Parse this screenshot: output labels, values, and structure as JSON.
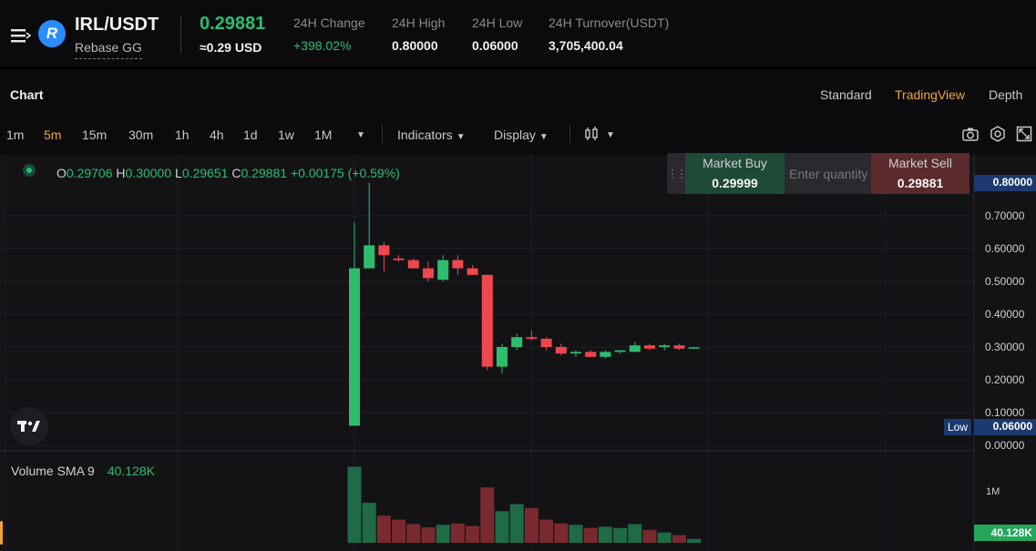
{
  "header": {
    "symbol": "IRL/USDT",
    "project": "Rebase GG",
    "logo_letter": "R",
    "last_price": "0.29881",
    "price_usd": "≈0.29 USD",
    "stats": [
      {
        "label": "24H Change",
        "value": "+398.02%"
      },
      {
        "label": "24H High",
        "value": "0.80000"
      },
      {
        "label": "24H Low",
        "value": "0.06000"
      },
      {
        "label": "24H Turnover(USDT)",
        "value": "3,705,400.04"
      }
    ]
  },
  "chart_header": {
    "title": "Chart",
    "views": [
      "Standard",
      "TradingView",
      "Depth"
    ],
    "active_view": "TradingView"
  },
  "toolbar": {
    "timeframes": [
      "1m",
      "5m",
      "15m",
      "30m",
      "1h",
      "4h",
      "1d",
      "1w",
      "1M"
    ],
    "active_timeframe": "5m",
    "indicators_label": "Indicators",
    "display_label": "Display",
    "icons": [
      "menu-icon",
      "candle-type-icon",
      "camera-icon",
      "settings-icon",
      "fullscreen-icon",
      "tradingview-logo-icon"
    ]
  },
  "ohlc": {
    "open_key": "O",
    "open": "0.29706",
    "high_key": "H",
    "high": "0.30000",
    "low_key": "L",
    "low": "0.29651",
    "close_key": "C",
    "close": "0.29881",
    "change": "+0.00175 (+0.59%)"
  },
  "trade_widget": {
    "buy_label": "Market Buy",
    "buy_price": "0.29999",
    "qty_placeholder": "Enter quantity",
    "sell_label": "Market Sell",
    "sell_price": "0.29881"
  },
  "price_scale": {
    "ticks": [
      "0.70000",
      "0.60000",
      "0.50000",
      "0.40000",
      "0.30000",
      "0.20000",
      "0.10000",
      "0.00000"
    ],
    "high_tag": "0.80000",
    "low_label": "Low",
    "low_tag": "0.06000"
  },
  "volume": {
    "legend_label": "Volume SMA 9",
    "legend_value": "40.128K",
    "scale_tick": "1M",
    "tag": "40.128K"
  },
  "colors": {
    "up": "#2ebd6e",
    "down": "#f0464e",
    "accent": "#f0a33a",
    "vol_up": "#1e6b46",
    "vol_down": "#7a2a2e"
  },
  "chart_data": {
    "type": "candlestick",
    "ylim": [
      0,
      0.8
    ],
    "candles": [
      {
        "o": 0.06,
        "h": 0.68,
        "l": 0.06,
        "c": 0.54
      },
      {
        "o": 0.54,
        "h": 0.8,
        "l": 0.54,
        "c": 0.61
      },
      {
        "o": 0.61,
        "h": 0.62,
        "l": 0.53,
        "c": 0.58
      },
      {
        "o": 0.57,
        "h": 0.58,
        "l": 0.56,
        "c": 0.565
      },
      {
        "o": 0.565,
        "h": 0.57,
        "l": 0.54,
        "c": 0.54
      },
      {
        "o": 0.54,
        "h": 0.56,
        "l": 0.5,
        "c": 0.51
      },
      {
        "o": 0.505,
        "h": 0.58,
        "l": 0.5,
        "c": 0.565
      },
      {
        "o": 0.565,
        "h": 0.58,
        "l": 0.52,
        "c": 0.54
      },
      {
        "o": 0.54,
        "h": 0.55,
        "l": 0.52,
        "c": 0.52
      },
      {
        "o": 0.52,
        "h": 0.52,
        "l": 0.23,
        "c": 0.24
      },
      {
        "o": 0.24,
        "h": 0.31,
        "l": 0.22,
        "c": 0.3
      },
      {
        "o": 0.3,
        "h": 0.34,
        "l": 0.29,
        "c": 0.33
      },
      {
        "o": 0.33,
        "h": 0.35,
        "l": 0.32,
        "c": 0.325
      },
      {
        "o": 0.325,
        "h": 0.33,
        "l": 0.29,
        "c": 0.3
      },
      {
        "o": 0.3,
        "h": 0.31,
        "l": 0.275,
        "c": 0.28
      },
      {
        "o": 0.28,
        "h": 0.29,
        "l": 0.27,
        "c": 0.285
      },
      {
        "o": 0.285,
        "h": 0.29,
        "l": 0.27,
        "c": 0.27
      },
      {
        "o": 0.27,
        "h": 0.29,
        "l": 0.265,
        "c": 0.285
      },
      {
        "o": 0.285,
        "h": 0.29,
        "l": 0.28,
        "c": 0.29
      },
      {
        "o": 0.285,
        "h": 0.315,
        "l": 0.285,
        "c": 0.305
      },
      {
        "o": 0.305,
        "h": 0.31,
        "l": 0.29,
        "c": 0.295
      },
      {
        "o": 0.3,
        "h": 0.31,
        "l": 0.29,
        "c": 0.305
      },
      {
        "o": 0.305,
        "h": 0.31,
        "l": 0.29,
        "c": 0.295
      },
      {
        "o": 0.297,
        "h": 0.3,
        "l": 0.296,
        "c": 0.299
      }
    ],
    "volumes": [
      1180000,
      620000,
      420000,
      360000,
      290000,
      240000,
      280000,
      300000,
      260000,
      860000,
      490000,
      600000,
      540000,
      360000,
      300000,
      280000,
      230000,
      250000,
      230000,
      290000,
      200000,
      160000,
      120000,
      60000
    ],
    "volume_max": 1300000
  }
}
